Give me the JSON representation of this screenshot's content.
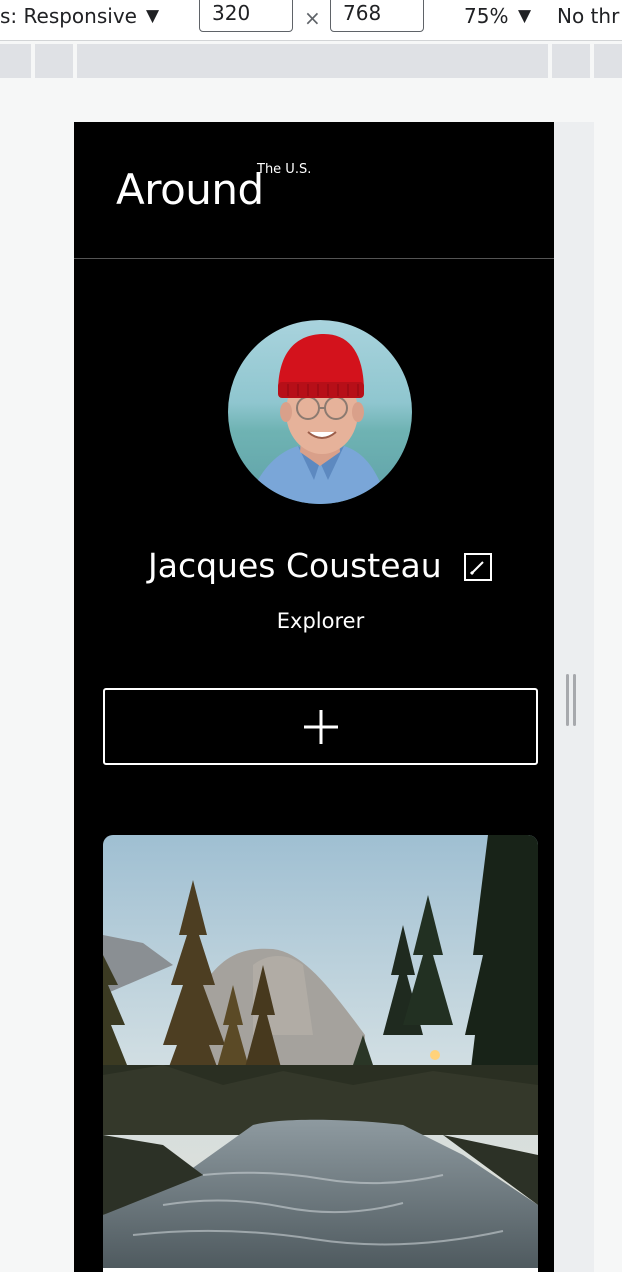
{
  "devtools": {
    "device_label": "s: Responsive",
    "width_value": "320",
    "times": "×",
    "height_value": "768",
    "zoom": "75%",
    "throttle": "No thr",
    "dropdown_glyph": "▼"
  },
  "page": {
    "logo": "Around",
    "logo_sup": "The U.S.",
    "profile": {
      "name": "Jacques Cousteau",
      "job": "Explorer"
    },
    "add_button_symbol": "+"
  },
  "colors": {
    "page_background": "#000000",
    "text": "#ffffff",
    "cap_red": "#d3121c"
  }
}
